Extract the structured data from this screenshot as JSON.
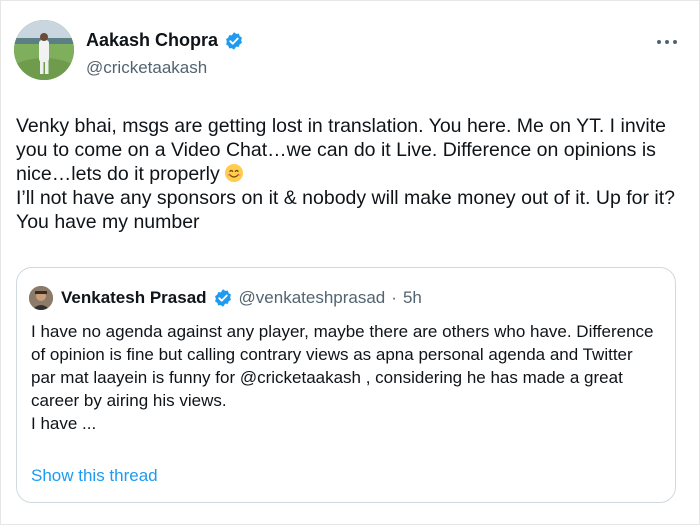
{
  "author": {
    "name": "Aakash Chopra",
    "handle": "@cricketaakash",
    "verified": true
  },
  "tweet": {
    "text": "Venky bhai, msgs are getting lost in translation. You here. Me on YT. I invite you to come on a Video Chat…we can do it Live. Difference on opinions is nice…lets do it properly",
    "text_line2": "I’ll not have any sponsors on it & nobody will make money out of it. Up for it? You have my number",
    "emoji": "smiling-face-emoji"
  },
  "more_icon": "more-horizontal-icon",
  "quoted_tweet": {
    "author_name": "Venkatesh Prasad",
    "author_handle": "@venkateshprasad",
    "separator": "·",
    "time_ago": "5h",
    "verified": true,
    "text": "I have no agenda against any player, maybe there are others who have. Difference of opinion is fine but calling contrary views as apna personal agenda and Twitter par mat laayein is funny for @cricketaakash , considering he has made a great career by airing his views.\nI have ...",
    "show_thread_label": "Show this thread"
  },
  "colors": {
    "verified_blue": "#1d9bf0",
    "link_blue": "#1d9bf0",
    "secondary_text": "#536471",
    "border": "#cfd9de"
  }
}
